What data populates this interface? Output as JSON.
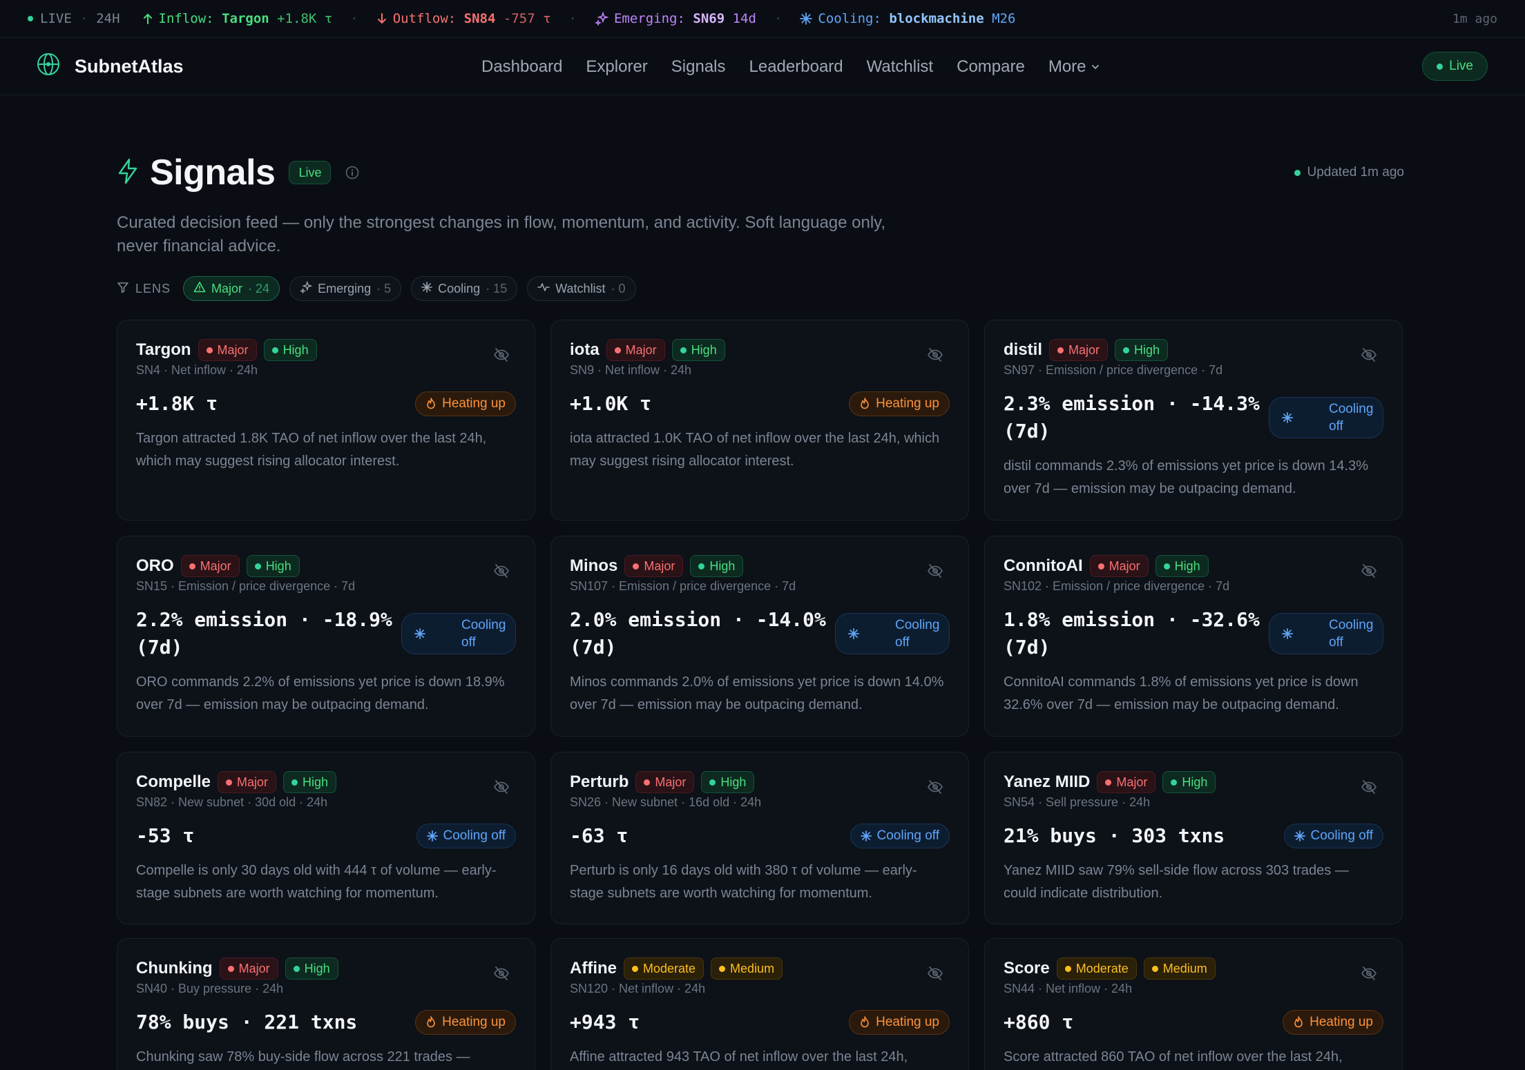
{
  "ticker": {
    "live": "LIVE",
    "window": "24H",
    "inflow_label": "Inflow:",
    "inflow_name": "Targon",
    "inflow_value": "+1.8K τ",
    "outflow_label": "Outflow:",
    "outflow_name": "SN84",
    "outflow_value": "-757 τ",
    "emerging_label": "Emerging:",
    "emerging_name": "SN69",
    "emerging_value": "14d",
    "cooling_label": "Cooling:",
    "cooling_name": "blockmachine",
    "cooling_value": "M26",
    "ago": "1m ago"
  },
  "nav": {
    "brand": "SubnetAtlas",
    "items": [
      "Dashboard",
      "Explorer",
      "Signals",
      "Leaderboard",
      "Watchlist",
      "Compare"
    ],
    "more": "More",
    "live": "Live"
  },
  "header": {
    "title": "Signals",
    "badge": "Live",
    "updated": "Updated 1m ago",
    "subtitle": "Curated decision feed — only the strongest changes in flow, momentum, and activity. Soft language only, never financial advice."
  },
  "lens": {
    "label": "LENS",
    "chips": [
      {
        "label": "Major",
        "count": "· 24"
      },
      {
        "label": "Emerging",
        "count": "· 5"
      },
      {
        "label": "Cooling",
        "count": "· 15"
      },
      {
        "label": "Watchlist",
        "count": "· 0"
      }
    ]
  },
  "cards": [
    {
      "name": "Targon",
      "severity": "Major",
      "confidence": "High",
      "meta": "SN4 · Net inflow · 24h",
      "metric": "+1.8K τ",
      "trend": "Heating up",
      "desc": "Targon attracted 1.8K TAO of net inflow over the last 24h, which may suggest rising allocator interest."
    },
    {
      "name": "iota",
      "severity": "Major",
      "confidence": "High",
      "meta": "SN9 · Net inflow · 24h",
      "metric": "+1.0K τ",
      "trend": "Heating up",
      "desc": "iota attracted 1.0K TAO of net inflow over the last 24h, which may suggest rising allocator interest."
    },
    {
      "name": "distil",
      "severity": "Major",
      "confidence": "High",
      "meta": "SN97 · Emission / price divergence · 7d",
      "metric": "2.3% emission · -14.3% (7d)",
      "trend": "Cooling off",
      "desc": "distil commands 2.3% of emissions yet price is down 14.3% over 7d — emission may be outpacing demand."
    },
    {
      "name": "ORO",
      "severity": "Major",
      "confidence": "High",
      "meta": "SN15 · Emission / price divergence · 7d",
      "metric": "2.2% emission · -18.9% (7d)",
      "trend": "Cooling off",
      "desc": "ORO commands 2.2% of emissions yet price is down 18.9% over 7d — emission may be outpacing demand."
    },
    {
      "name": "Minos",
      "severity": "Major",
      "confidence": "High",
      "meta": "SN107 · Emission / price divergence · 7d",
      "metric": "2.0% emission · -14.0% (7d)",
      "trend": "Cooling off",
      "desc": "Minos commands 2.0% of emissions yet price is down 14.0% over 7d — emission may be outpacing demand."
    },
    {
      "name": "ConnitoAI",
      "severity": "Major",
      "confidence": "High",
      "meta": "SN102 · Emission / price divergence · 7d",
      "metric": "1.8% emission · -32.6% (7d)",
      "trend": "Cooling off",
      "desc": "ConnitoAI commands 1.8% of emissions yet price is down 32.6% over 7d — emission may be outpacing demand."
    },
    {
      "name": "Compelle",
      "severity": "Major",
      "confidence": "High",
      "meta": "SN82 · New subnet · 30d old · 24h",
      "metric": "-53 τ",
      "trend": "Cooling off",
      "desc": "Compelle is only 30 days old with 444 τ of volume — early-stage subnets are worth watching for momentum."
    },
    {
      "name": "Perturb",
      "severity": "Major",
      "confidence": "High",
      "meta": "SN26 · New subnet · 16d old · 24h",
      "metric": "-63 τ",
      "trend": "Cooling off",
      "desc": "Perturb is only 16 days old with 380 τ of volume — early-stage subnets are worth watching for momentum."
    },
    {
      "name": "Yanez MIID",
      "severity": "Major",
      "confidence": "High",
      "meta": "SN54 · Sell pressure · 24h",
      "metric": "21% buys · 303 txns",
      "trend": "Cooling off",
      "desc": "Yanez MIID saw 79% sell-side flow across 303 trades — could indicate distribution."
    },
    {
      "name": "Chunking",
      "severity": "Major",
      "confidence": "High",
      "meta": "SN40 · Buy pressure · 24h",
      "metric": "78% buys · 221 txns",
      "trend": "Heating up",
      "desc": "Chunking saw 78% buy-side flow across 221 trades —"
    },
    {
      "name": "Affine",
      "severity": "Moderate",
      "confidence": "Medium",
      "meta": "SN120 · Net inflow · 24h",
      "metric": "+943 τ",
      "trend": "Heating up",
      "desc": "Affine attracted 943 TAO of net inflow over the last 24h,"
    },
    {
      "name": "Score",
      "severity": "Moderate",
      "confidence": "Medium",
      "meta": "SN44 · Net inflow · 24h",
      "metric": "+860 τ",
      "trend": "Heating up",
      "desc": "Score attracted 860 TAO of net inflow over the last 24h,"
    }
  ]
}
